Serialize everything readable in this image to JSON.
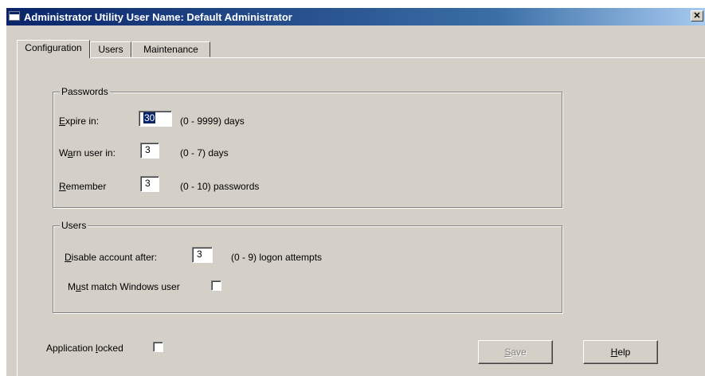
{
  "window": {
    "title": "Administrator Utility  User Name: Default Administrator",
    "close_glyph": "✕"
  },
  "tabs": [
    {
      "label": "Configuration",
      "active": true
    },
    {
      "label": "Users",
      "active": false
    },
    {
      "label": "Maintenance",
      "active": false
    }
  ],
  "passwords": {
    "legend": "Passwords",
    "expire": {
      "mnemonic": "E",
      "rest": "xpire in:",
      "value": "30",
      "range": "(0 - 9999) days"
    },
    "warn": {
      "pre": "W",
      "mnemonic": "a",
      "rest": "rn user in:",
      "value": "3",
      "range": "(0 - 7) days"
    },
    "remember": {
      "mnemonic": "R",
      "rest": "emember",
      "value": "3",
      "range": "(0 - 10) passwords"
    }
  },
  "users": {
    "legend": "Users",
    "disable": {
      "mnemonic": "D",
      "rest": "isable account after:",
      "value": "3",
      "range": "(0 - 9) logon attempts"
    },
    "must_match": {
      "pre": "M",
      "mnemonic": "u",
      "rest": "st match Windows user",
      "checked": false
    }
  },
  "app_locked": {
    "pre": "Application ",
    "mnemonic": "l",
    "rest": "ocked",
    "checked": false
  },
  "buttons": {
    "save": {
      "mnemonic": "S",
      "rest": "ave",
      "enabled": false
    },
    "help": {
      "mnemonic": "H",
      "rest": "elp",
      "enabled": true
    }
  },
  "colors": {
    "titlebar": "#0a246a",
    "face": "#d4d0c8",
    "selection": "#0a246a"
  }
}
